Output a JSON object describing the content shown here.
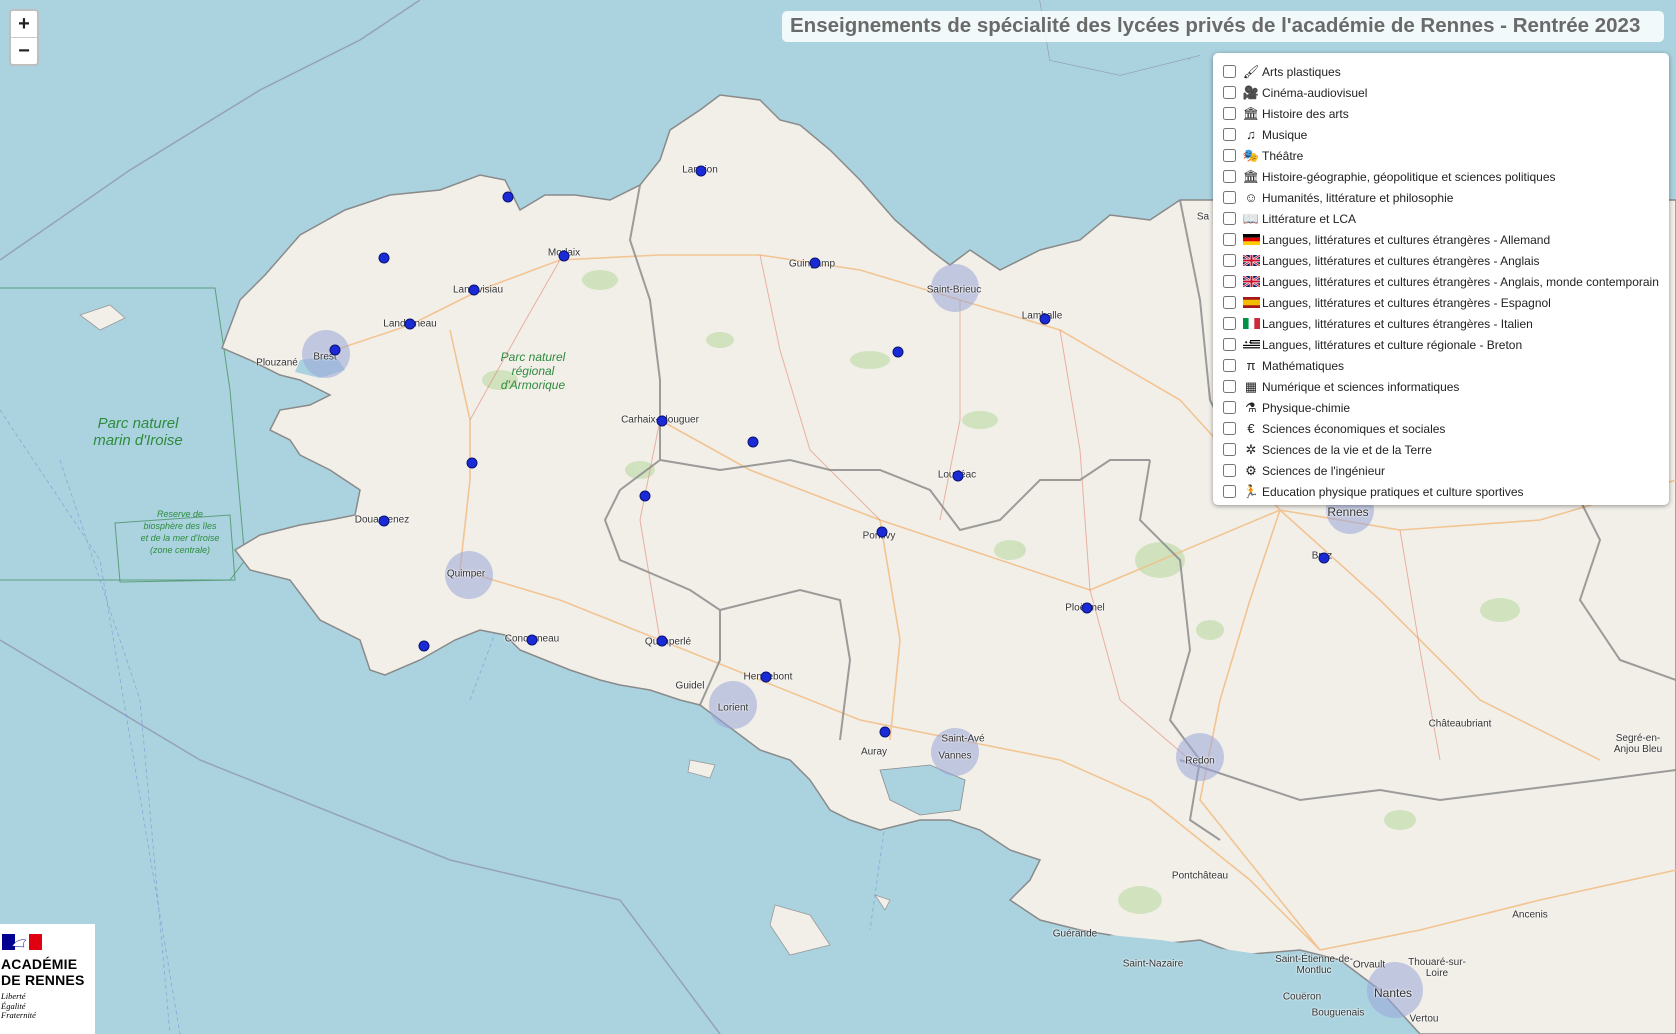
{
  "title": "Enseignements de spécialité des lycées privés de l'académie de Rennes - Rentrée 2023",
  "zoom": {
    "in_label": "+",
    "out_label": "−"
  },
  "legend": [
    {
      "label": "Arts plastiques",
      "icon": "paintbrush-icon",
      "glyph": "🖌"
    },
    {
      "label": "Cinéma-audiovisuel",
      "icon": "video-camera-icon",
      "glyph": "🎥"
    },
    {
      "label": "Histoire des arts",
      "icon": "column-icon",
      "glyph": "🏛"
    },
    {
      "label": "Musique",
      "icon": "music-note-icon",
      "glyph": "♫"
    },
    {
      "label": "Théâtre",
      "icon": "theater-curtain-icon",
      "glyph": "🎭"
    },
    {
      "label": "Histoire-géographie, géopolitique et sciences politiques",
      "icon": "landmark-icon",
      "glyph": "🏛"
    },
    {
      "label": "Humanités, littérature et philosophie",
      "icon": "thinker-head-icon",
      "glyph": "☺"
    },
    {
      "label": "Littérature et LCA",
      "icon": "open-book-icon",
      "glyph": "📖"
    },
    {
      "label": "Langues, littératures et cultures étrangères - Allemand",
      "icon": "flag-germany-icon",
      "flag": "de"
    },
    {
      "label": "Langues, littératures et cultures étrangères - Anglais",
      "icon": "flag-uk-icon",
      "flag": "uk"
    },
    {
      "label": "Langues, littératures et cultures étrangères - Anglais, monde contemporain",
      "icon": "flag-uk-icon",
      "flag": "uk"
    },
    {
      "label": "Langues, littératures et cultures étrangères - Espagnol",
      "icon": "flag-spain-icon",
      "flag": "es"
    },
    {
      "label": "Langues, littératures et cultures étrangères - Italien",
      "icon": "flag-italy-icon",
      "flag": "it"
    },
    {
      "label": "Langues, littératures et culture régionale - Breton",
      "icon": "flag-brittany-icon",
      "flag": "bzh"
    },
    {
      "label": "Mathématiques",
      "icon": "pi-icon",
      "glyph": "π"
    },
    {
      "label": "Numérique et sciences informatiques",
      "icon": "binary-icon",
      "glyph": "▦"
    },
    {
      "label": "Physique-chimie",
      "icon": "flask-icon",
      "glyph": "⚗"
    },
    {
      "label": "Sciences économiques et sociales",
      "icon": "euro-icon",
      "glyph": "€"
    },
    {
      "label": "Sciences de la vie et de la Terre",
      "icon": "virus-icon",
      "glyph": "✲"
    },
    {
      "label": "Sciences de l'ingénieur",
      "icon": "gears-icon",
      "glyph": "⚙"
    },
    {
      "label": "Education physique pratiques et culture sportives",
      "icon": "runner-icon",
      "glyph": "🏃"
    }
  ],
  "places": [
    "Lannion",
    "Morlaix",
    "Guingamp",
    "Saint-Brieuc",
    "Landivisiau",
    "Landerneau",
    "Lamballe",
    "Brest",
    "Plouzané",
    "Carhaix-Plouguer",
    "Loudéac",
    "Douarnenez",
    "Pontivy",
    "Quimper",
    "Ploërmel",
    "Concarneau",
    "Quimperlé",
    "Hennebont",
    "Guidel",
    "Lorient",
    "Auray",
    "Saint-Avé",
    "Vannes",
    "Redon",
    "Rennes",
    "Bruz",
    "Châteaubriant",
    "Segré-en-Anjou Bleu",
    "Pontchâteau",
    "Ancenis",
    "Guérande",
    "Saint-Nazaire",
    "Orvault",
    "Thouaré-sur-Loire",
    "Saint-Étienne-de-Montluc",
    "Nantes",
    "Couëron",
    "Bouguenais",
    "Vertou",
    "Sa"
  ],
  "parks": {
    "armorique": "Parc naturel régional d'Armorique",
    "iroise": "Parc naturel marin d'Iroise",
    "biosphere": "Reserve de biosphère des îles et de la mer d'Iroise (zone centrale)"
  },
  "logo": {
    "line1": "ACADÉMIE",
    "line2": "DE RENNES",
    "motto": [
      "Liberté",
      "Égalité",
      "Fraternité"
    ]
  },
  "colors": {
    "marker": "#1a2ad6",
    "sea": "#aad3df",
    "land": "#f2efe9",
    "region_border": "#7a7a7a"
  }
}
